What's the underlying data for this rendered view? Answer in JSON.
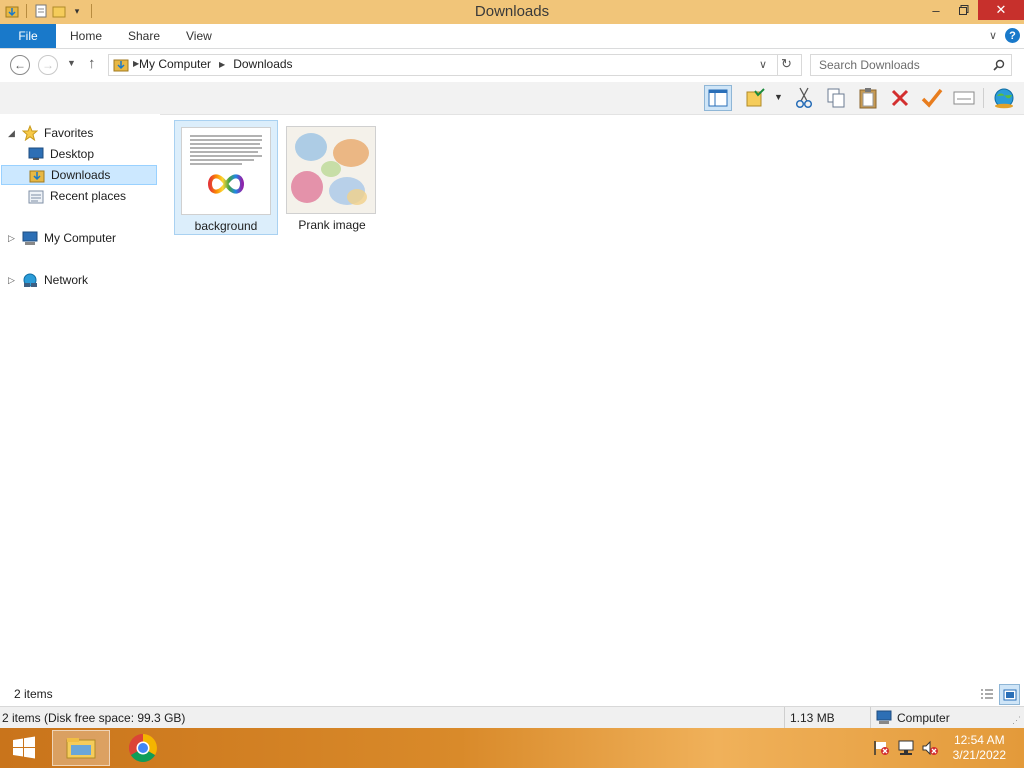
{
  "window": {
    "title": "Downloads"
  },
  "ribbon": {
    "file": "File",
    "tabs": [
      "Home",
      "Share",
      "View"
    ]
  },
  "address": {
    "crumbs": [
      "My Computer",
      "Downloads"
    ],
    "search_placeholder": "Search Downloads"
  },
  "navigation": {
    "favorites": "Favorites",
    "desktop": "Desktop",
    "downloads": "Downloads",
    "recent": "Recent places",
    "my_computer": "My Computer",
    "network": "Network"
  },
  "files": [
    {
      "name": "background",
      "selected": true
    },
    {
      "name": "Prank image",
      "selected": false
    }
  ],
  "status": {
    "item_count": "2 items",
    "details": "2 items (Disk free space: 99.3 GB)",
    "size": "1.13 MB",
    "location": "Computer"
  },
  "taskbar": {
    "time": "12:54 AM",
    "date": "3/21/2022"
  },
  "colors": {
    "accent": "#1979ca",
    "titlebar": "#f1c579",
    "close": "#c7302c",
    "selection": "#cce8ff"
  }
}
